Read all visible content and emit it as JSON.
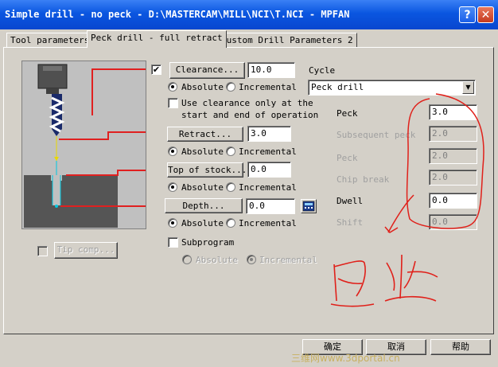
{
  "window": {
    "title": "Simple drill - no peck - D:\\MASTERCAM\\MILL\\NCI\\T.NCI - MPFAN",
    "help_glyph": "?",
    "close_glyph": "✕"
  },
  "tabs": [
    {
      "label": "Tool parameters",
      "active": false
    },
    {
      "label": "Peck drill - full retract",
      "active": true
    },
    {
      "label": "Custom Drill Parameters 2",
      "active": false
    }
  ],
  "tip_comp": {
    "label": "Tip comp...",
    "checked": false,
    "enabled": false
  },
  "clearance": {
    "checked": true,
    "button_label": "Clearance...",
    "value": "10.0",
    "absolute_label": "Absolute",
    "incremental_label": "Incremental",
    "mode": "absolute",
    "only_at_start_end_line1": "Use clearance only at the",
    "only_at_start_end_line2": "start and end of operation",
    "only_at_start_end_checked": false
  },
  "retract": {
    "button_label": "Retract...",
    "value": "3.0",
    "absolute_label": "Absolute",
    "incremental_label": "Incremental",
    "mode": "absolute"
  },
  "top_of_stock": {
    "button_label": "Top of stock...",
    "value": "0.0",
    "absolute_label": "Absolute",
    "incremental_label": "Incremental",
    "mode": "absolute"
  },
  "depth": {
    "button_label": "Depth...",
    "value": "0.0",
    "absolute_label": "Absolute",
    "incremental_label": "Incremental",
    "mode": "absolute"
  },
  "subprogram": {
    "label": "Subprogram",
    "checked": false,
    "absolute_label": "Absolute",
    "incremental_label": "Incremental",
    "mode": "incremental",
    "enabled": false
  },
  "cycle": {
    "label": "Cycle",
    "selected": "Peck drill",
    "params": [
      {
        "label": "Peck",
        "value": "3.0",
        "enabled": true
      },
      {
        "label": "Subsequent peck",
        "value": "2.0",
        "enabled": false
      },
      {
        "label": "Peck",
        "value": "2.0",
        "enabled": false
      },
      {
        "label": "Chip break",
        "value": "2.0",
        "enabled": false
      },
      {
        "label": "Dwell",
        "value": "0.0",
        "enabled": true
      },
      {
        "label": "Shift",
        "value": "0.0",
        "enabled": false
      }
    ]
  },
  "buttons": {
    "ok": "确定",
    "cancel": "取消",
    "help": "帮助"
  },
  "watermark": "三维网www.3dportal.cn",
  "colors": {
    "title_bar": "#0a56e0",
    "annotation_red": "#e0201a",
    "dialog_bg": "#d4d0c8"
  }
}
